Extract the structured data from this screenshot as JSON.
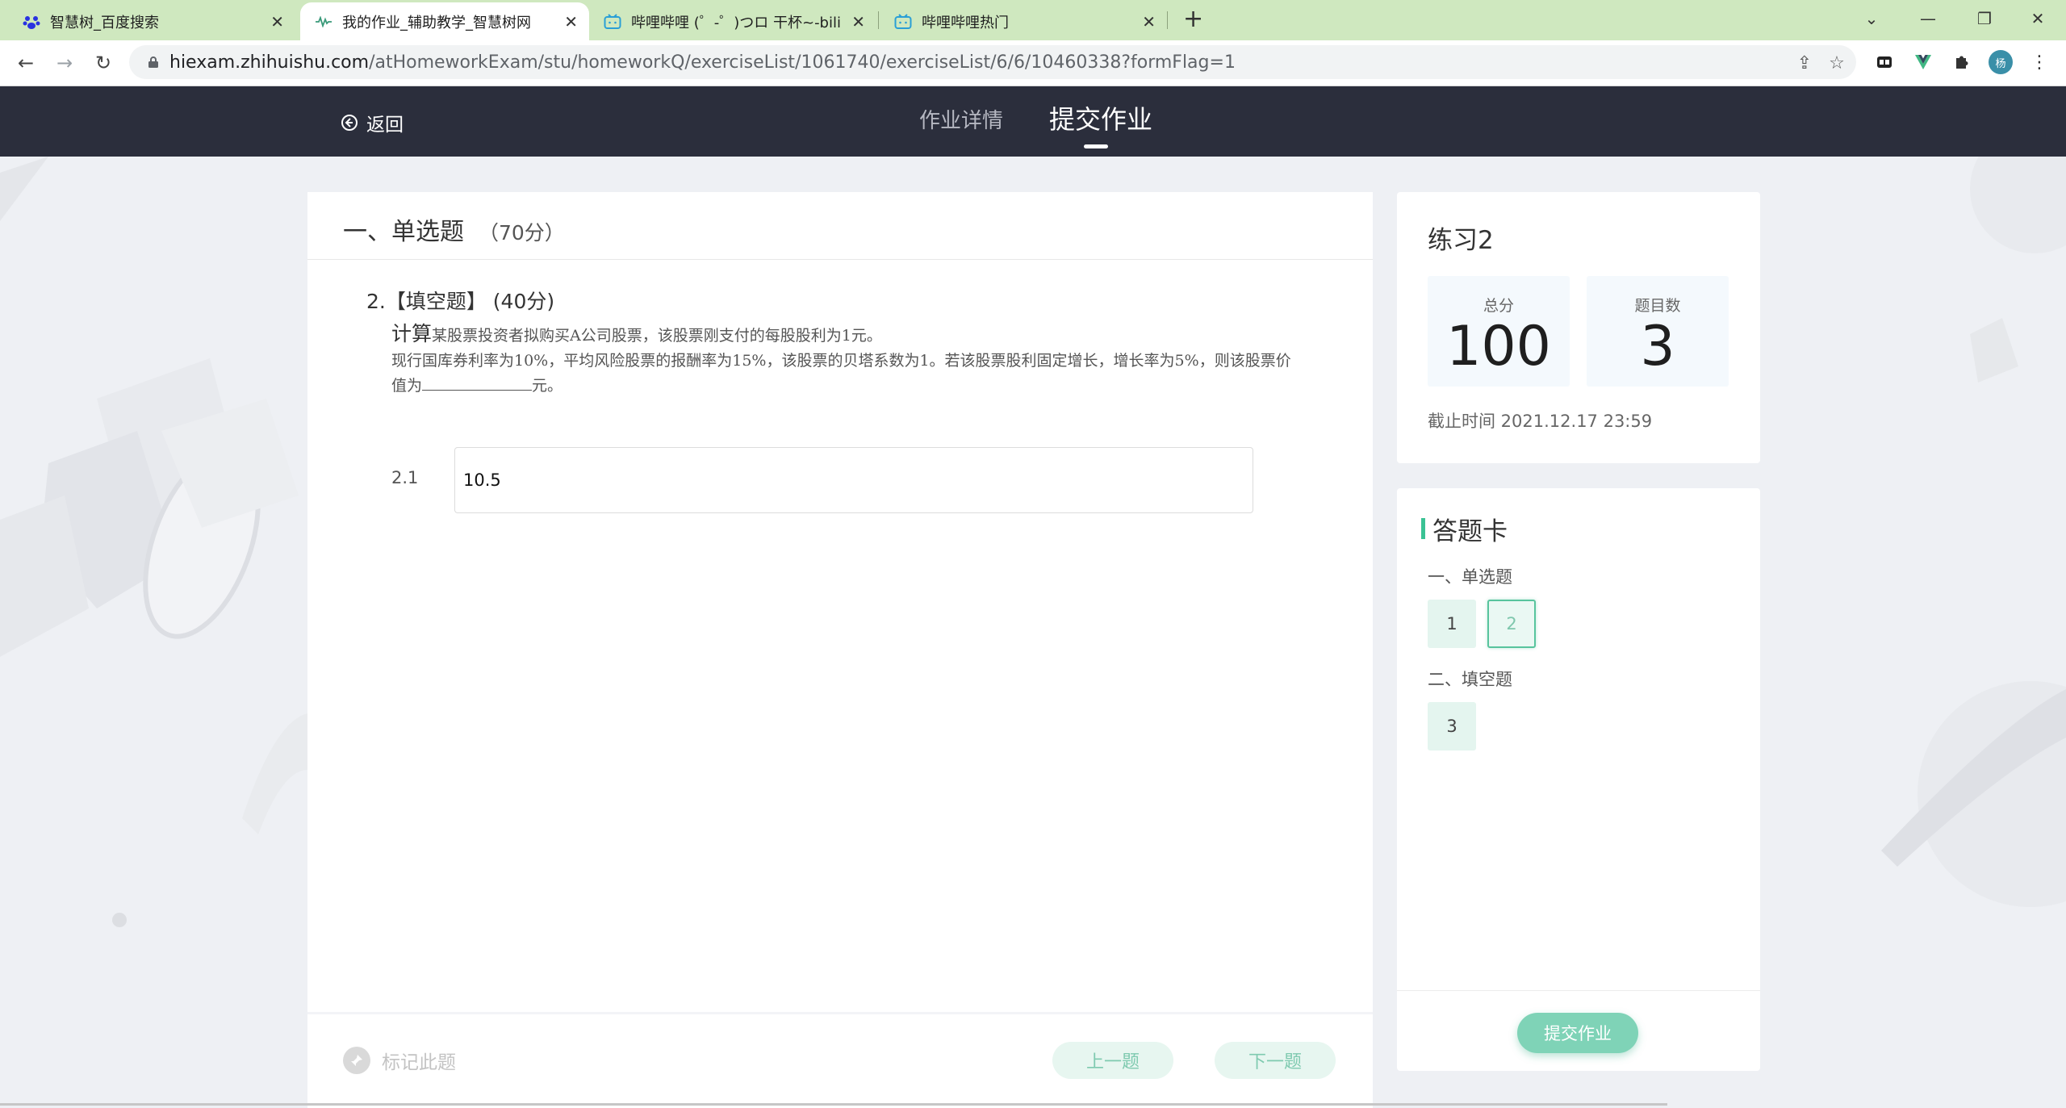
{
  "browser": {
    "tabs": [
      {
        "title": "智慧树_百度搜索",
        "icon": "baidu-paw-icon",
        "active": false
      },
      {
        "title": "我的作业_辅助教学_智慧树网",
        "icon": "zhihuishu-icon",
        "active": true
      },
      {
        "title": "哔哩哔哩 (゜-゜)つロ 干杯~-bilibili",
        "icon": "bilibili-icon",
        "active": false
      },
      {
        "title": "哔哩哔哩热门",
        "icon": "bilibili-icon",
        "active": false
      }
    ],
    "url_host": "hiexam.zhihuishu.com",
    "url_path": "/atHomeworkExam/stu/homeworkQ/exerciseList/1061740/exerciseList/6/6/10460338?formFlag=1",
    "profile_initial": "杨"
  },
  "header": {
    "back_label": "返回",
    "tab_detail": "作业详情",
    "tab_submit": "提交作业"
  },
  "question": {
    "section_title": "一、单选题",
    "section_score": "（70分）",
    "number_line": "2.【填空题】 (40分)",
    "lead": "计算",
    "text_line1": "某股票投资者拟购买A公司股票，该股票刚支付的每股股利为1元。",
    "text_line2": "现行国库券利率为10%，平均风险股票的报酬率为15%，该股票的贝塔系数为1。若该股票股利固定增长，增长率为5%，则该股票价",
    "text_line3_pre": "值为",
    "text_line3_post": "元。",
    "answer_label": "2.1",
    "answer_value": "10.5"
  },
  "footer": {
    "mark_label": "标记此题",
    "prev_label": "上一题",
    "next_label": "下一题"
  },
  "info": {
    "name": "练习2",
    "total_label": "总分",
    "total_value": "100",
    "count_label": "题目数",
    "count_value": "3",
    "deadline": "截止时间 2021.12.17 23:59"
  },
  "answer_card": {
    "title": "答题卡",
    "sections": [
      {
        "title": "一、单选题",
        "items": [
          "1",
          "2"
        ]
      },
      {
        "title": "二、填空题",
        "items": [
          "3"
        ]
      }
    ],
    "submit_label": "提交作业"
  },
  "colors": {
    "header_bg": "#2b2e3c",
    "accent": "#3ac294",
    "tabbar_bg": "#cfe8bf"
  }
}
